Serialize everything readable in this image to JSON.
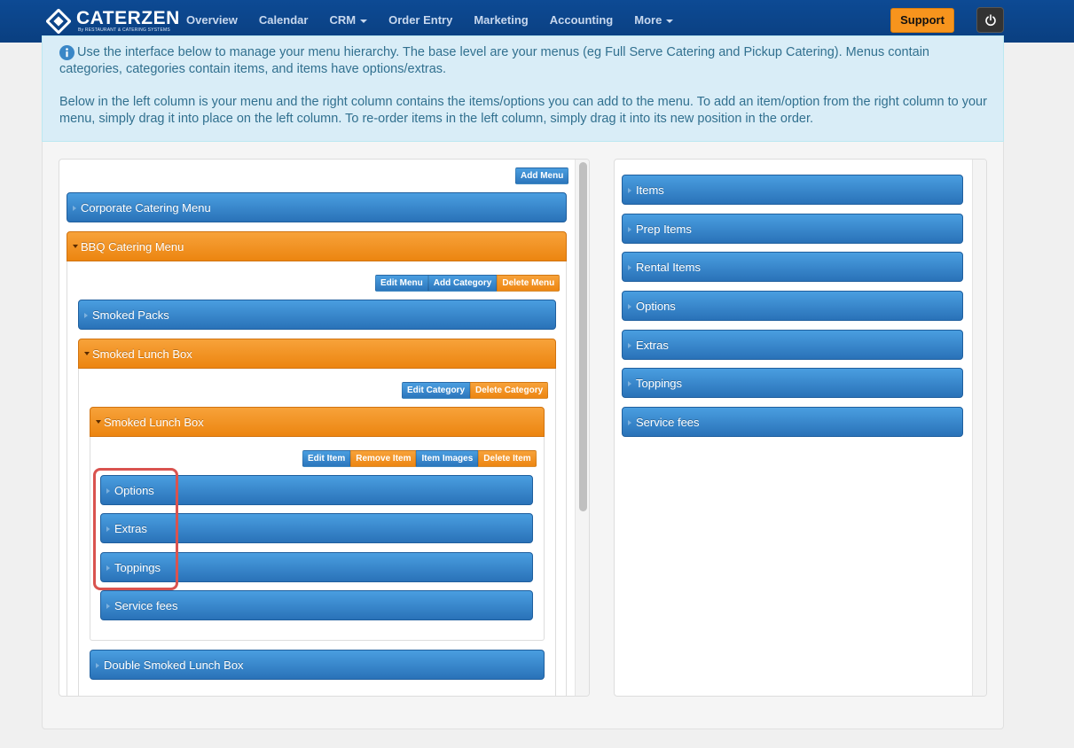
{
  "nav": {
    "brand": "CATERZEN",
    "brand_sub": "By RESTAURANT & CATERING SYSTEMS",
    "items": [
      {
        "label": "Overview"
      },
      {
        "label": "Calendar"
      },
      {
        "label": "CRM"
      },
      {
        "label": "Order Entry"
      },
      {
        "label": "Marketing"
      },
      {
        "label": "Accounting"
      },
      {
        "label": "More"
      }
    ],
    "support_label": "Support",
    "power_icon": "power-icon"
  },
  "info": {
    "icon": "info-circle-icon",
    "paragraph1": "Use the interface below to manage your menu hierarchy. The base level are your menus (eg Full Serve Catering and Pickup Catering). Menus contain categories, categories contain items, and items have options/extras.",
    "paragraph2": "Below in the left column is your menu and the right column contains the items/options you can add to the menu. To add an item/option from the right column to your menu, simply drag it into place on the left column. To re-order items in the left column, simply drag it into its new position in the order."
  },
  "left": {
    "add_menu_label": "Add Menu",
    "menus": [
      {
        "label": "Corporate Catering Menu"
      },
      {
        "label": "BBQ Catering Menu"
      }
    ],
    "menu_buttons": [
      "Edit Menu",
      "Add Category",
      "Delete Menu"
    ],
    "categories": [
      {
        "label": "Smoked Packs"
      },
      {
        "label": "Smoked Lunch Box"
      }
    ],
    "category_buttons": [
      "Edit Category",
      "Delete Category"
    ],
    "item": {
      "label": "Smoked Lunch Box"
    },
    "item_buttons": [
      "Edit Item",
      "Remove Item",
      "Item Images",
      "Delete Item"
    ],
    "groups": [
      {
        "label": "Options"
      },
      {
        "label": "Extras"
      },
      {
        "label": "Toppings"
      },
      {
        "label": "Service fees"
      }
    ],
    "next_item": {
      "label": "Double Smoked Lunch Box"
    }
  },
  "right": {
    "items": [
      {
        "label": "Items"
      },
      {
        "label": "Prep Items"
      },
      {
        "label": "Rental Items"
      },
      {
        "label": "Options"
      },
      {
        "label": "Extras"
      },
      {
        "label": "Toppings"
      },
      {
        "label": "Service fees"
      }
    ]
  },
  "colors": {
    "navbar": "#0d4a94",
    "blue_bar": "#2a72b8",
    "orange_bar": "#ec8510",
    "info_bg": "#d9edf7",
    "highlight": "#d9534f"
  }
}
